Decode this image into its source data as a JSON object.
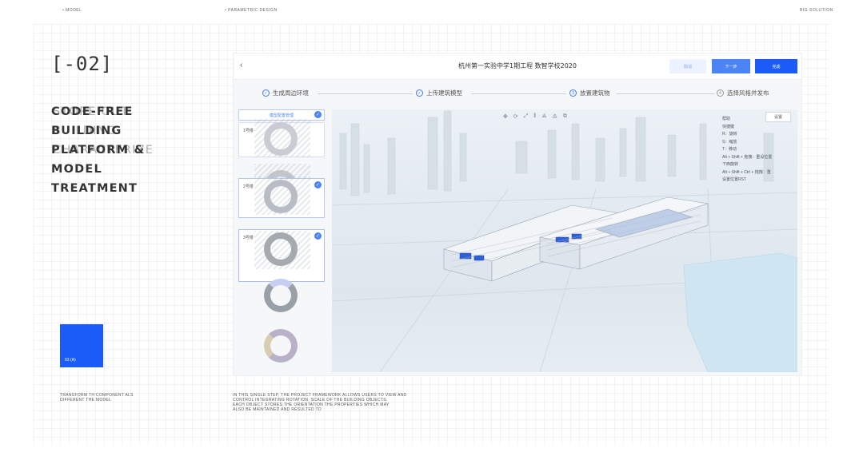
{
  "top_labels": {
    "left": "• MODEL",
    "center": "• PARAMETRIC DESIGN",
    "right": "BIG SOLUTION"
  },
  "section_number": "[-02]",
  "headline": [
    "CODE-FREE",
    "BUILDING",
    "PLATFORM &",
    "MODEL",
    "TREATMENT"
  ],
  "headline_ghost": [
    "STORE OUT",
    "BUILDING",
    "CHARACTERIZE"
  ],
  "blue_card_label": "03 (A)",
  "captions": {
    "left": [
      "TRANSFORM TH COMPONENT ALS",
      "DIFFERENT THE MODEL"
    ],
    "center": [
      "IN THIS SINGLE STEP, THE PROJECT FRAMEWORK ALLOWS USERS TO VIEW AND",
      "CONTROL INTEGRATING ROTATION, SCALE OF THE BUILDING OBJECTS.",
      "EACH OBJECT STORES THE ORIENTATION THE PROPERTIES WHICH MAY",
      "ALSO BE MAINTAINED AND RESULTED TO"
    ]
  },
  "app": {
    "title": "杭州第一实验中学1期工程 数智学校2020",
    "back_icon": "chevron-left-icon",
    "buttons": {
      "cancel": "取消",
      "next": "下一步",
      "done": "完成"
    },
    "steps": [
      {
        "num": "✓",
        "label": "生成周边环境",
        "done": true
      },
      {
        "num": "✓",
        "label": "上传建筑模型",
        "done": true
      },
      {
        "num": "3",
        "label": "放置建筑物",
        "done": false,
        "active": true
      },
      {
        "num": "4",
        "label": "选择风格并发布",
        "done": false
      }
    ],
    "model_manage_label": "模型配置管理",
    "buildings": [
      "1号楼",
      "2号楼",
      "3号楼"
    ],
    "toolbar_icons": [
      "move-icon",
      "rotate-icon",
      "scale-icon",
      "measure-icon",
      "snap-icon",
      "layer-icon",
      "copy-icon"
    ],
    "toolbar_glyphs": [
      "✥",
      "⟳",
      "⤢",
      "⫴",
      "⟁",
      "♳",
      "⧉"
    ],
    "settings_label": "设置",
    "help": [
      "帮助",
      "快捷键",
      "R：旋转",
      "S：缩放",
      "T：移动",
      "Alt + Shift + 拖拽：重设位置",
      "下西旋转",
      "Alt + Shift + Ctrl + 拖拽：重",
      "设置位置RST"
    ]
  }
}
